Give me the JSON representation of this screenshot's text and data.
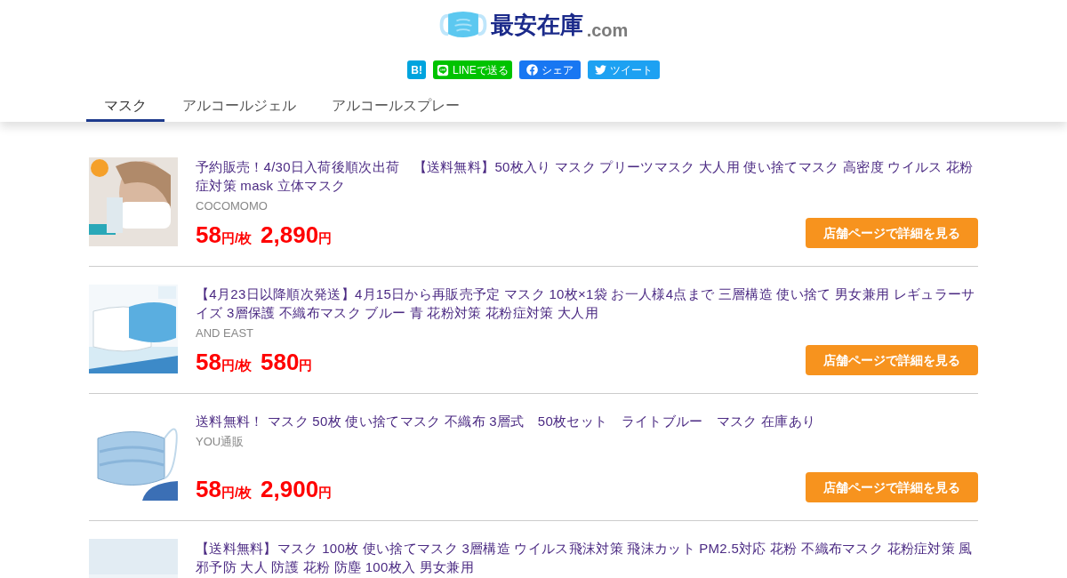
{
  "logo": {
    "name": "最安在庫",
    "domain": ".com"
  },
  "share_buttons": [
    {
      "kind": "hatena",
      "label": "B!"
    },
    {
      "kind": "line",
      "label": "LINEで送る"
    },
    {
      "kind": "facebook",
      "label": "シェア"
    },
    {
      "kind": "twitter",
      "label": "ツイート"
    }
  ],
  "tabs": [
    {
      "label": "マスク",
      "selected": true
    },
    {
      "label": "アルコールジェル",
      "selected": false
    },
    {
      "label": "アルコールスプレー",
      "selected": false
    }
  ],
  "products": [
    {
      "title": "予約販売！4/30日入荷後順次出荷　【送料無料】50枚入り マスク プリーツマスク 大人用 使い捨てマスク 高密度 ウイルス 花粉症対策 mask 立体マスク",
      "shop": "COCOMOMO",
      "unit_price": "58",
      "unit_suffix": "円/枚",
      "price": "2,890",
      "price_suffix": "円",
      "button": "店舗ページで詳細を見る"
    },
    {
      "title": "【4月23日以降順次発送】4月15日から再販売予定 マスク 10枚×1袋 お一人様4点まで 三層構造 使い捨て 男女兼用 レギュラーサイズ 3層保護 不織布マスク ブルー 青 花粉対策 花粉症対策 大人用",
      "shop": "AND EAST",
      "unit_price": "58",
      "unit_suffix": "円/枚",
      "price": "580",
      "price_suffix": "円",
      "button": "店舗ページで詳細を見る"
    },
    {
      "title": "送料無料！ マスク 50枚 使い捨てマスク 不織布 3層式　50枚セット　ライトブルー　マスク 在庫あり",
      "shop": "YOU通販",
      "unit_price": "58",
      "unit_suffix": "円/枚",
      "price": "2,900",
      "price_suffix": "円",
      "button": "店舗ページで詳細を見る"
    },
    {
      "title": "【送料無料】マスク 100枚 使い捨てマスク 3層構造 ウイルス飛沫対策 飛沫カット PM2.5対応 花粉 不織布マスク 花粉症対策 風邪予防 大人 防護 花粉 防塵 100枚入 男女兼用"
    }
  ]
}
